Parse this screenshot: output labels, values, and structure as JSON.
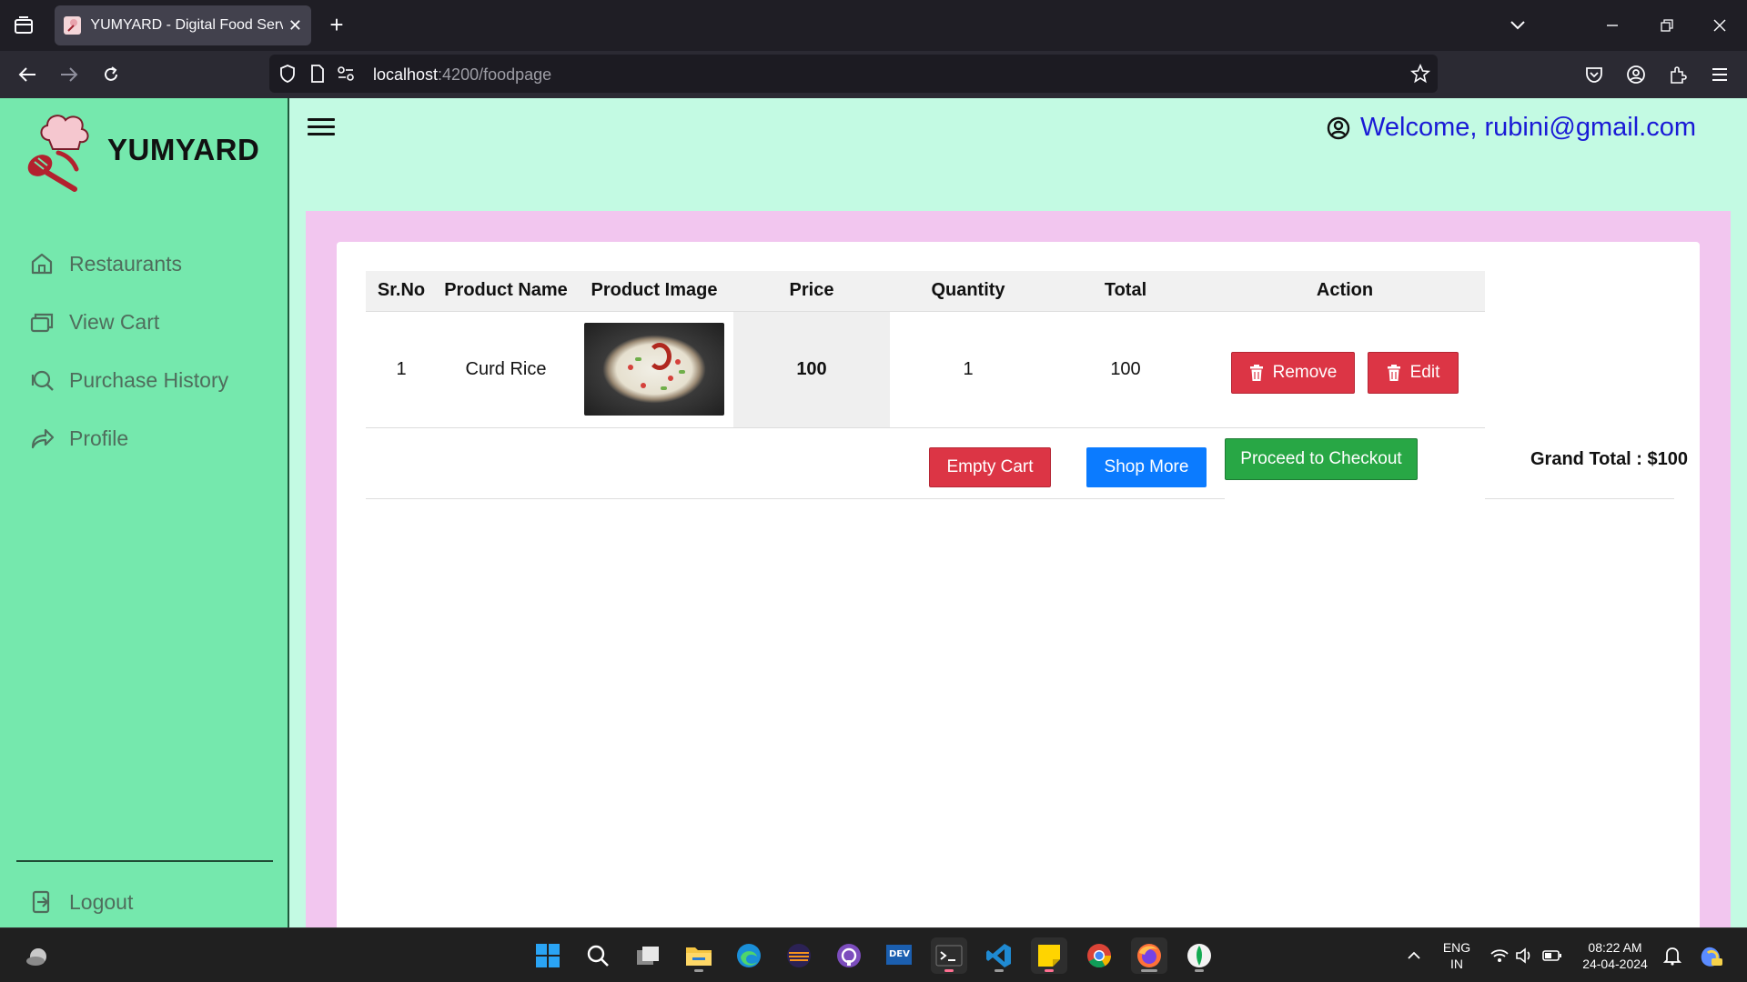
{
  "browser": {
    "tab_title": "YUMYARD - Digital Food Service",
    "tab_close": "✕",
    "new_tab": "+",
    "url_host": "localhost",
    "url_path": ":4200/foodpage"
  },
  "app": {
    "brand": "YUMYARD",
    "welcome": "Welcome, rubini@gmail.com"
  },
  "sidebar": {
    "items": [
      {
        "label": "Restaurants",
        "icon": "home-icon"
      },
      {
        "label": "View Cart",
        "icon": "cards-icon"
      },
      {
        "label": "Purchase History",
        "icon": "search-history-icon"
      },
      {
        "label": "Profile",
        "icon": "share-arrow-icon"
      }
    ],
    "logout": "Logout"
  },
  "cart": {
    "headers": [
      "Sr.No",
      "Product Name",
      "Product Image",
      "Price",
      "Quantity",
      "Total",
      "Action"
    ],
    "rows": [
      {
        "srno": "1",
        "name": "Curd Rice",
        "price": "100",
        "quantity": "1",
        "total": "100",
        "remove": "Remove",
        "edit": "Edit"
      }
    ],
    "empty_cart": "Empty Cart",
    "shop_more": "Shop More",
    "checkout": "Proceed to Checkout",
    "grand_total": "Grand Total : $100"
  },
  "taskbar": {
    "lang_line1": "ENG",
    "lang_line2": "IN",
    "time": "08:22 AM",
    "date": "24-04-2024"
  },
  "colors": {
    "page_bg": "#c3fae3",
    "sidebar_bg": "#75e8ad",
    "panel_bg": "#f2c6ef",
    "danger": "#dc3545",
    "primary": "#0b7bff",
    "success": "#28a745",
    "welcome": "#1a1ad6"
  }
}
